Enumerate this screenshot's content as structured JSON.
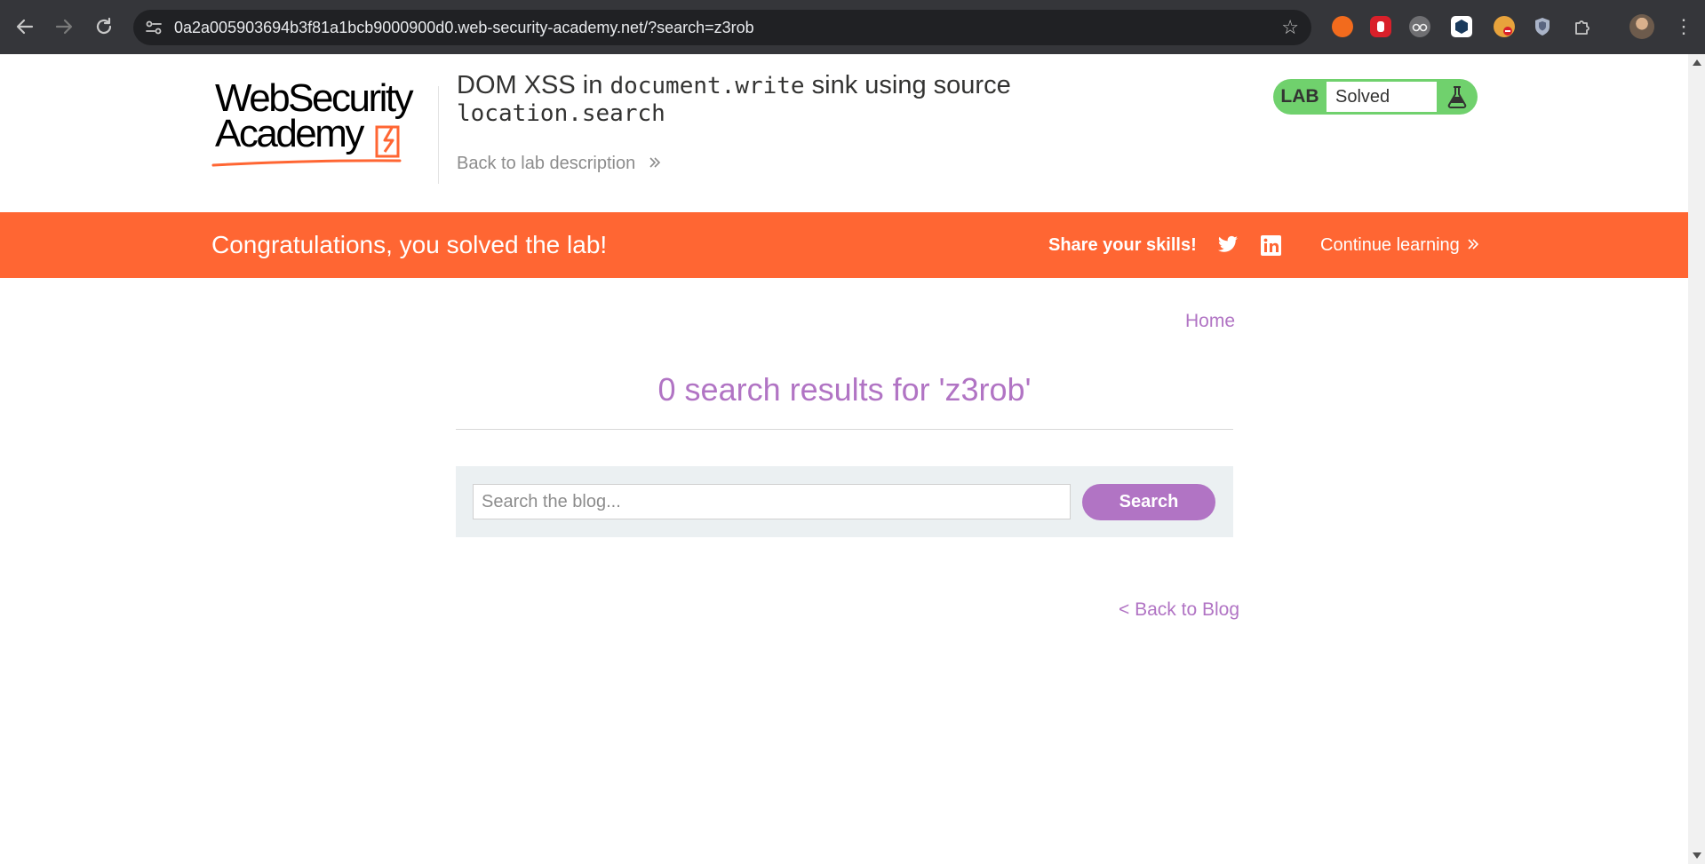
{
  "browser": {
    "url": "0a2a005903694b3f81a1bcb9000900d0.web-security-academy.net/?search=z3rob",
    "icons": [
      "back-arrow-icon",
      "forward-arrow-icon",
      "reload-icon",
      "site-info-icon",
      "bookmark-star-icon",
      "extensions-puzzle-icon",
      "more-menu-icon"
    ],
    "extensions": [
      {
        "name": "burp-extension-icon",
        "color": "#f26b1d"
      },
      {
        "name": "stop-hand-extension-icon",
        "color": "#d9202a"
      },
      {
        "name": "glasses-extension-icon",
        "color": "#9aa0a6"
      },
      {
        "name": "cube-extension-icon",
        "color": "#ffffff"
      },
      {
        "name": "cookie-extension-icon",
        "color": "#e8a33c"
      },
      {
        "name": "shield-extension-icon",
        "color": "#aab4c8"
      }
    ]
  },
  "header": {
    "logo_line1": "WebSecurity",
    "logo_line2": "Academy",
    "title_prefix": "DOM XSS in ",
    "title_code1": "document.write",
    "title_middle": " sink using source",
    "title_code2": "location.search",
    "back_link": "Back to lab description",
    "lab_tag": "LAB",
    "lab_status": "Solved",
    "status_color": "#70d16d"
  },
  "banner": {
    "message": "Congratulations, you solved the lab!",
    "share_label": "Share your skills!",
    "continue_label": "Continue learning",
    "color": "#ff6633"
  },
  "main": {
    "home_link": "Home",
    "results_heading": "0 search results for 'z3rob'",
    "search_placeholder": "Search the blog...",
    "search_value": "",
    "search_button": "Search",
    "back_link": "< Back to Blog",
    "accent_color": "#b174c4"
  }
}
